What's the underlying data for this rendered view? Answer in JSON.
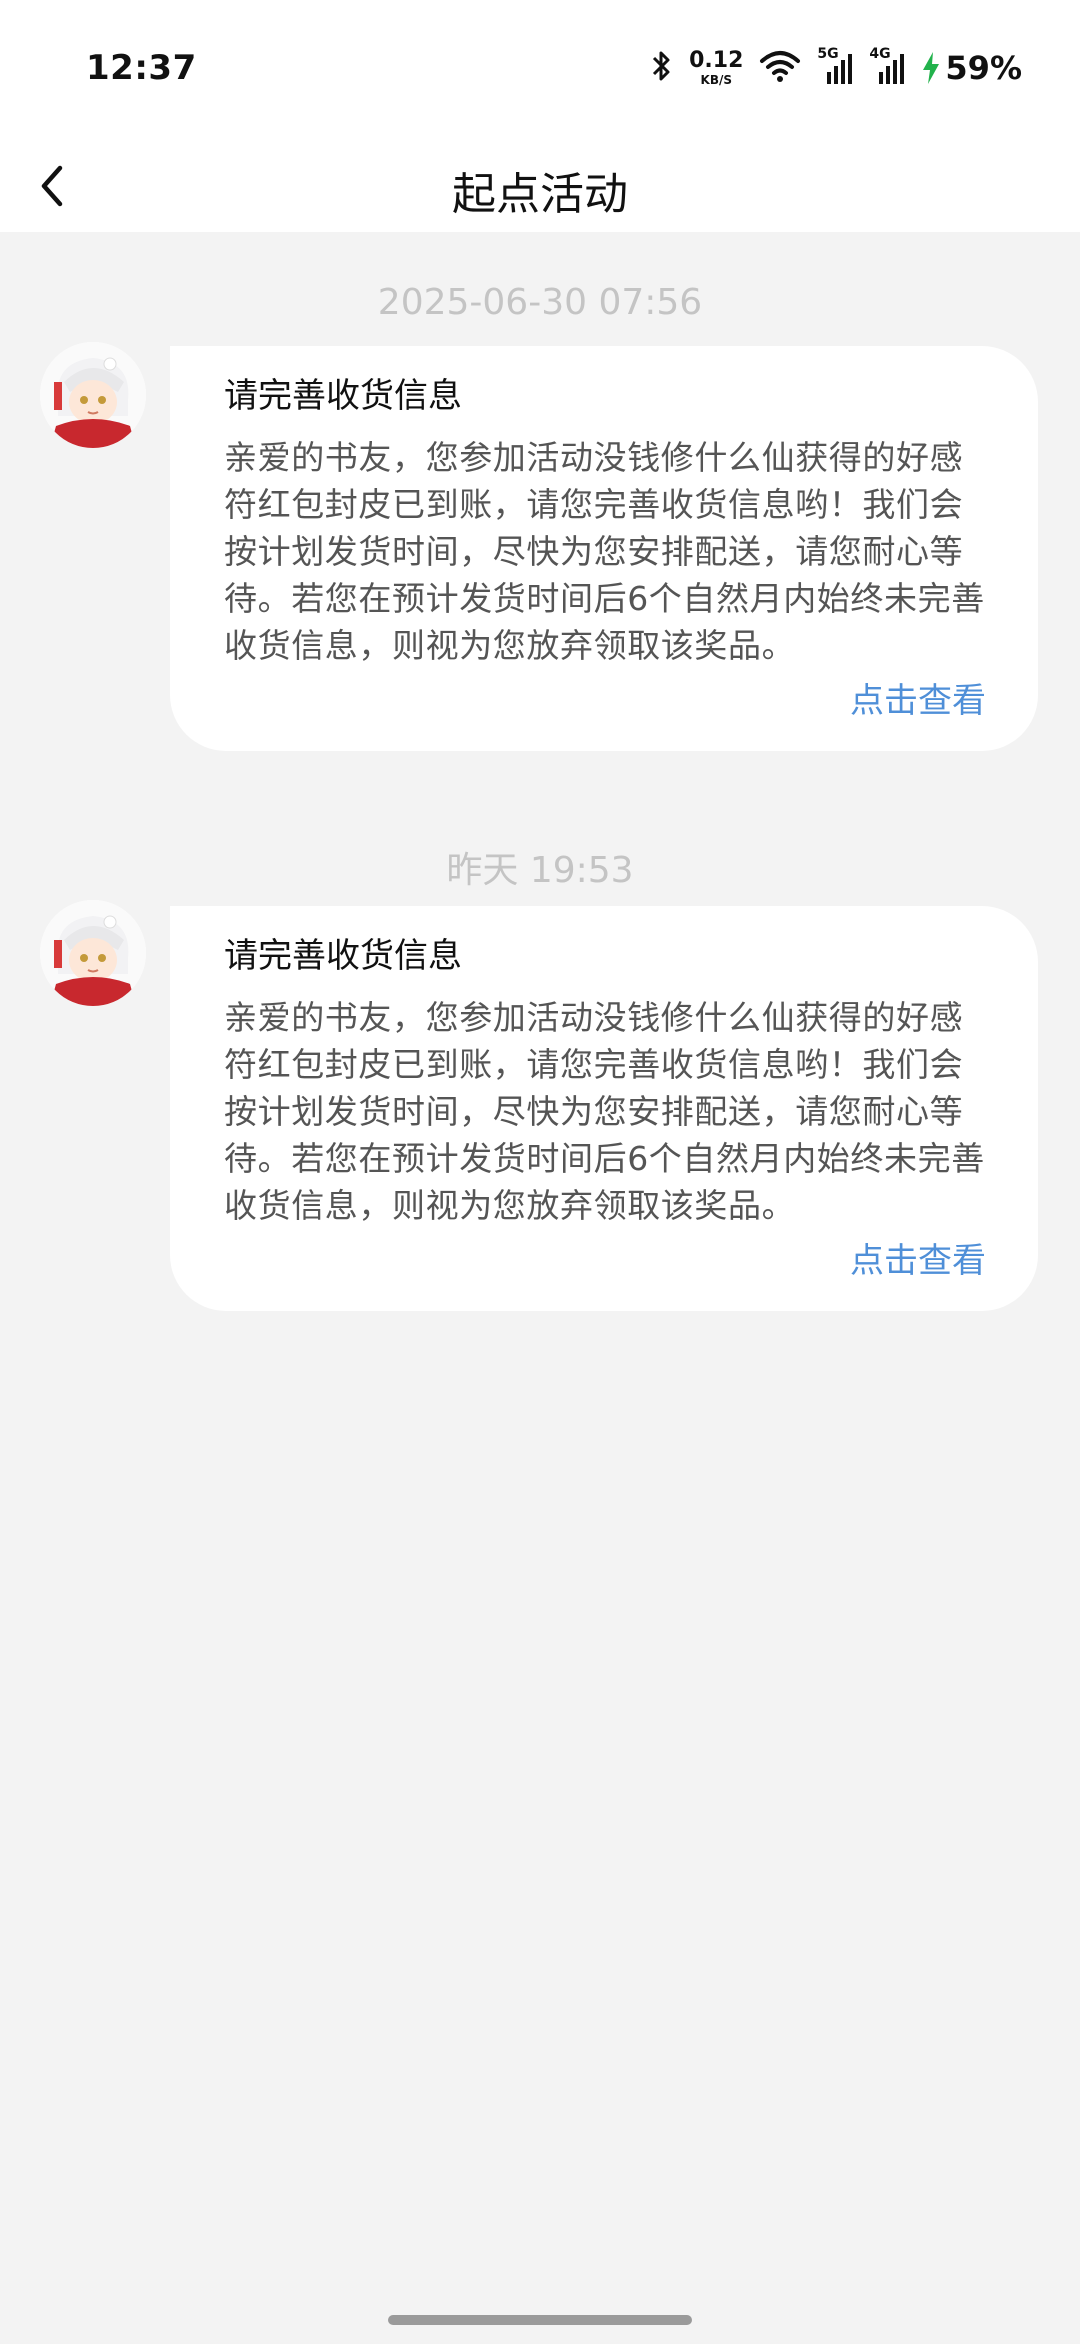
{
  "status_bar": {
    "time": "12:37",
    "net_speed_value": "0.12",
    "net_speed_unit": "KB/S",
    "sig1_tag": "5G",
    "sig2_tag": "4G",
    "battery": "59%",
    "icons": [
      "bluetooth-icon",
      "wifi-icon",
      "signal-icon",
      "signal-icon",
      "charging-icon"
    ]
  },
  "header": {
    "title": "起点活动",
    "back_icon": "back-arrow-icon"
  },
  "messages": [
    {
      "time": "2025-06-30 07:56",
      "title": "请完善收货信息",
      "body": "亲爱的书友，您参加活动没钱修什么仙获得的好感符红包封皮已到账，请您完善收货信息哟！我们会按计划发货时间，尽快为您安排配送，请您耐心等待。若您在预计发货时间后6个自然月内始终未完善收货信息，则视为您放弃领取该奖品。",
      "link": "点击查看"
    },
    {
      "time": "昨天 19:53",
      "title": "请完善收货信息",
      "body": "亲爱的书友，您参加活动没钱修什么仙获得的好感符红包封皮已到账，请您完善收货信息哟！我们会按计划发货时间，尽快为您安排配送，请您耐心等待。若您在预计发货时间后6个自然月内始终未完善收货信息，则视为您放弃领取该奖品。",
      "link": "点击查看"
    }
  ],
  "colors": {
    "background": "#f3f3f3",
    "link": "#4f8fd8",
    "timestamp": "#c4c4c4"
  }
}
